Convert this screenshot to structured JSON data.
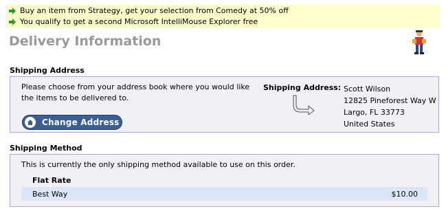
{
  "promotions": [
    "Buy an item from Strategy, get your selection from Comedy at 50% off",
    "You qualify to get a second Microsoft IntelliMouse Explorer free"
  ],
  "page_title": "Delivery Information",
  "shipping_address": {
    "heading": "Shipping Address",
    "instructions": "Please choose from your address book where you would like the items to be delivered to.",
    "change_button_label": "Change Address",
    "address_label": "Shipping Address:",
    "address_lines": [
      "Scott Wilson",
      "12825 Pineforest Way W",
      "Largo, FL 33773",
      "United States"
    ]
  },
  "shipping_method": {
    "heading": "Shipping Method",
    "note": "This is currently the only shipping method available to use on this order.",
    "rate_group": "Flat Rate",
    "option_name": "Best Way",
    "option_price": "$10.00"
  },
  "colors": {
    "promo_bg": "#ffffcc",
    "panel_bg": "#f1f1f5",
    "selected_row_bg": "#dbe7f7",
    "button_bg": "#3b5f93",
    "title_color": "#999999"
  },
  "icons": [
    "green-arrow-icon",
    "mascot-icon",
    "house-icon",
    "curved-arrow-icon"
  ]
}
